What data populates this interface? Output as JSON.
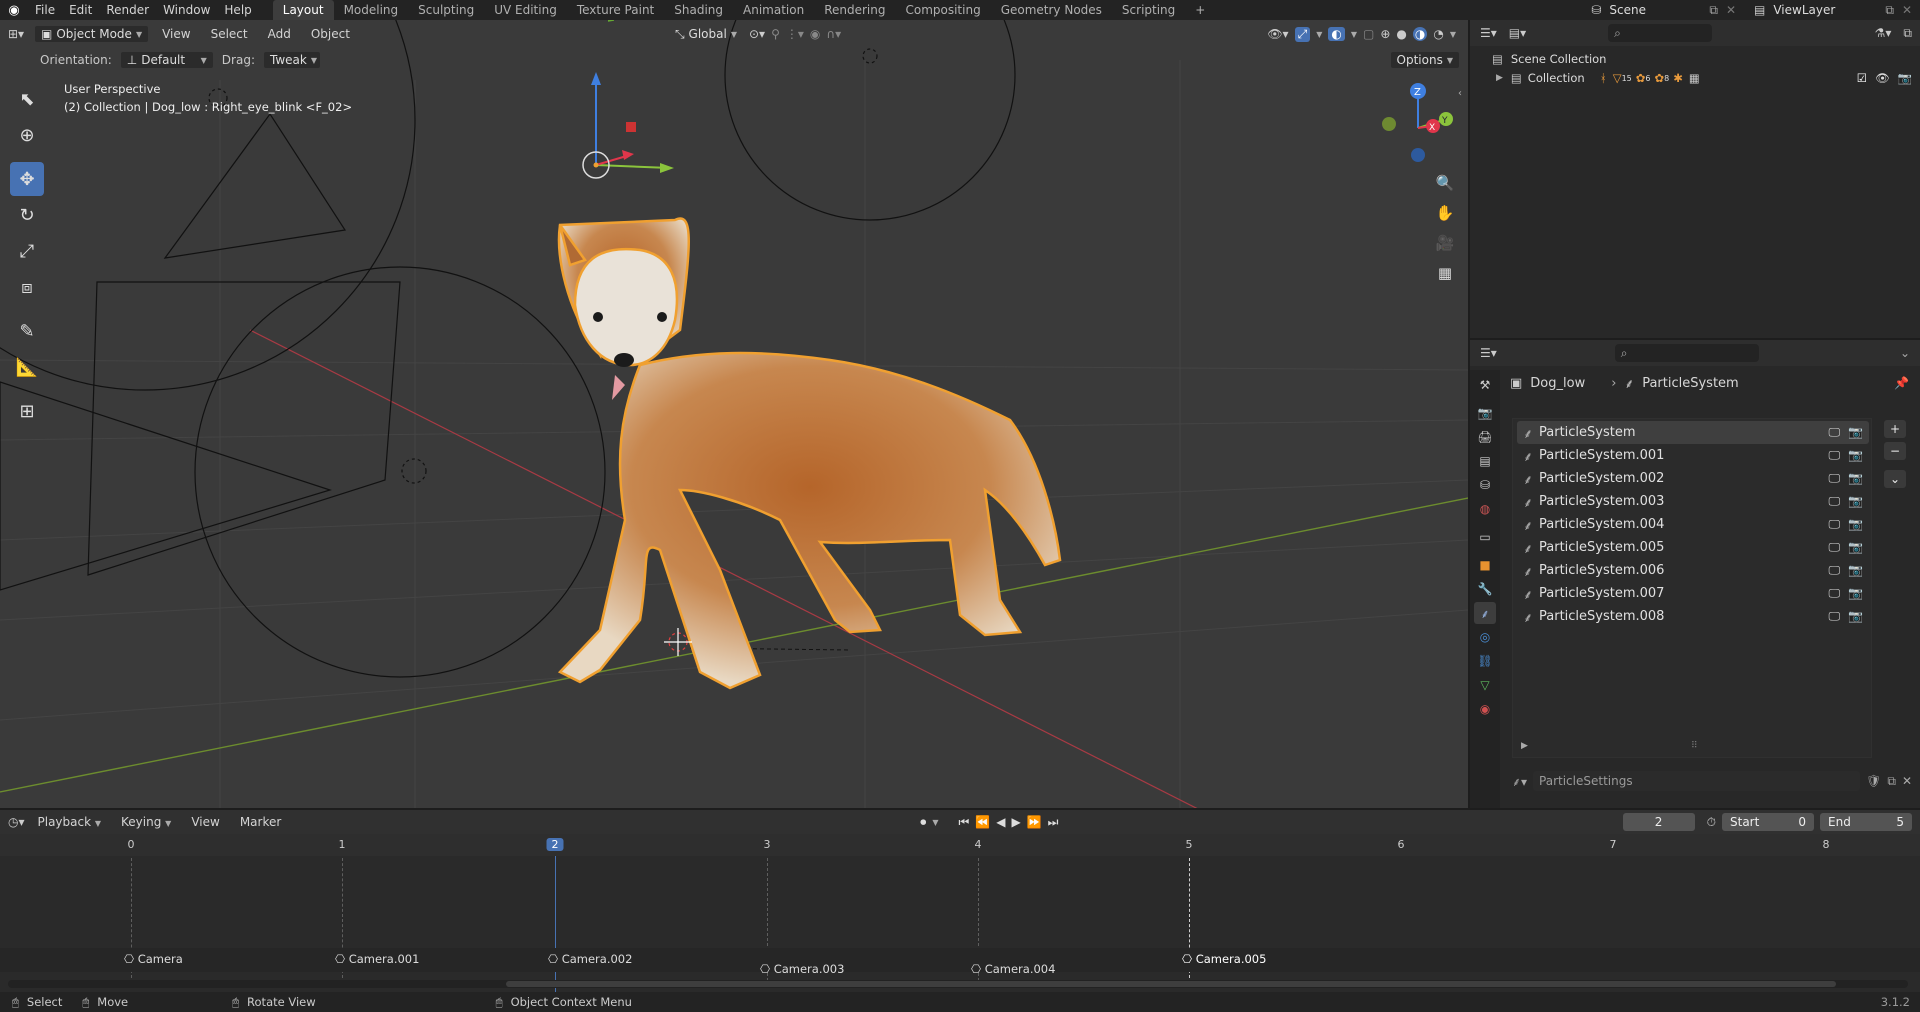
{
  "topbar": {
    "menus": [
      "File",
      "Edit",
      "Render",
      "Window",
      "Help"
    ],
    "workspaces": [
      "Layout",
      "Modeling",
      "Sculpting",
      "UV Editing",
      "Texture Paint",
      "Shading",
      "Animation",
      "Rendering",
      "Compositing",
      "Geometry Nodes",
      "Scripting"
    ],
    "add_tab": "+",
    "scene": "Scene",
    "view_layer": "ViewLayer"
  },
  "viewport": {
    "mode": "Object Mode",
    "menus": [
      "View",
      "Select",
      "Add",
      "Object"
    ],
    "transform_orientation": "Global",
    "orientation_label": "Orientation:",
    "orientation_value": "Default",
    "drag_label": "Drag:",
    "drag_value": "Tweak",
    "options": "Options",
    "overlay_line1": "User Perspective",
    "overlay_line2": "(2) Collection | Dog_low : Right_eye_blink <F_02>",
    "gizmo_axes": [
      "X",
      "Y",
      "Z"
    ]
  },
  "outliner": {
    "scene_collection": "Scene Collection",
    "collection": "Collection",
    "collection_counts": [
      "15",
      "6",
      "8"
    ]
  },
  "properties": {
    "breadcrumb_object": "Dog_low",
    "breadcrumb_item": "ParticleSystem",
    "particle_systems": [
      "ParticleSystem",
      "ParticleSystem.001",
      "ParticleSystem.002",
      "ParticleSystem.003",
      "ParticleSystem.004",
      "ParticleSystem.005",
      "ParticleSystem.006",
      "ParticleSystem.007",
      "ParticleSystem.008"
    ],
    "active_index": 0,
    "settings_field": "ParticleSettings"
  },
  "timeline": {
    "menus": [
      "Playback",
      "Keying",
      "View",
      "Marker"
    ],
    "current_frame": "2",
    "start_label": "Start",
    "start_value": "0",
    "end_label": "End",
    "end_value": "5",
    "ticks": [
      "0",
      "1",
      "2",
      "3",
      "4",
      "5",
      "6",
      "7",
      "8"
    ],
    "markers": [
      "Camera",
      "Camera.001",
      "Camera.002",
      "Camera.003",
      "Camera.004",
      "Camera.005"
    ]
  },
  "statusbar": {
    "select": "Select",
    "move": "Move",
    "rotate": "Rotate View",
    "context": "Object Context Menu",
    "version": "3.1.2"
  },
  "colors": {
    "accent": "#4772b3",
    "selection_outline": "#f0a030",
    "x_axis": "#e0364b",
    "y_axis": "#8bc43c",
    "z_axis": "#3f7fe0"
  }
}
